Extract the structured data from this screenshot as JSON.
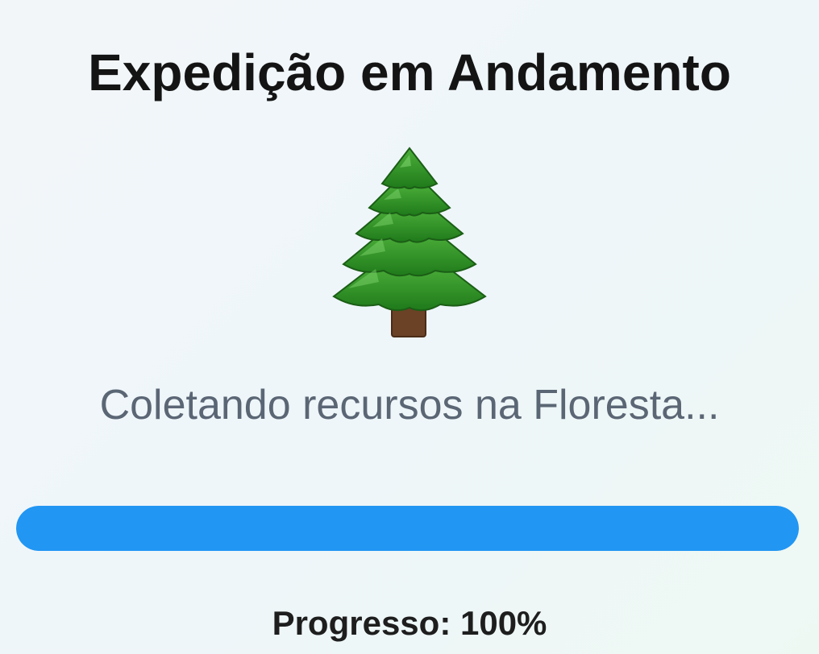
{
  "header": {
    "title": "Expedição em Andamento"
  },
  "expedition": {
    "icon": "evergreen-tree-icon",
    "status_text": "Coletando recursos na Floresta..."
  },
  "progress": {
    "label_prefix": "Progresso: ",
    "value_text": "100%",
    "fraction": 1.0,
    "fill_color": "#2196f3"
  },
  "colors": {
    "title": "#141414",
    "status_text": "#5b6675",
    "tree_foliage": "#2e8b22",
    "tree_trunk": "#6b4226"
  }
}
